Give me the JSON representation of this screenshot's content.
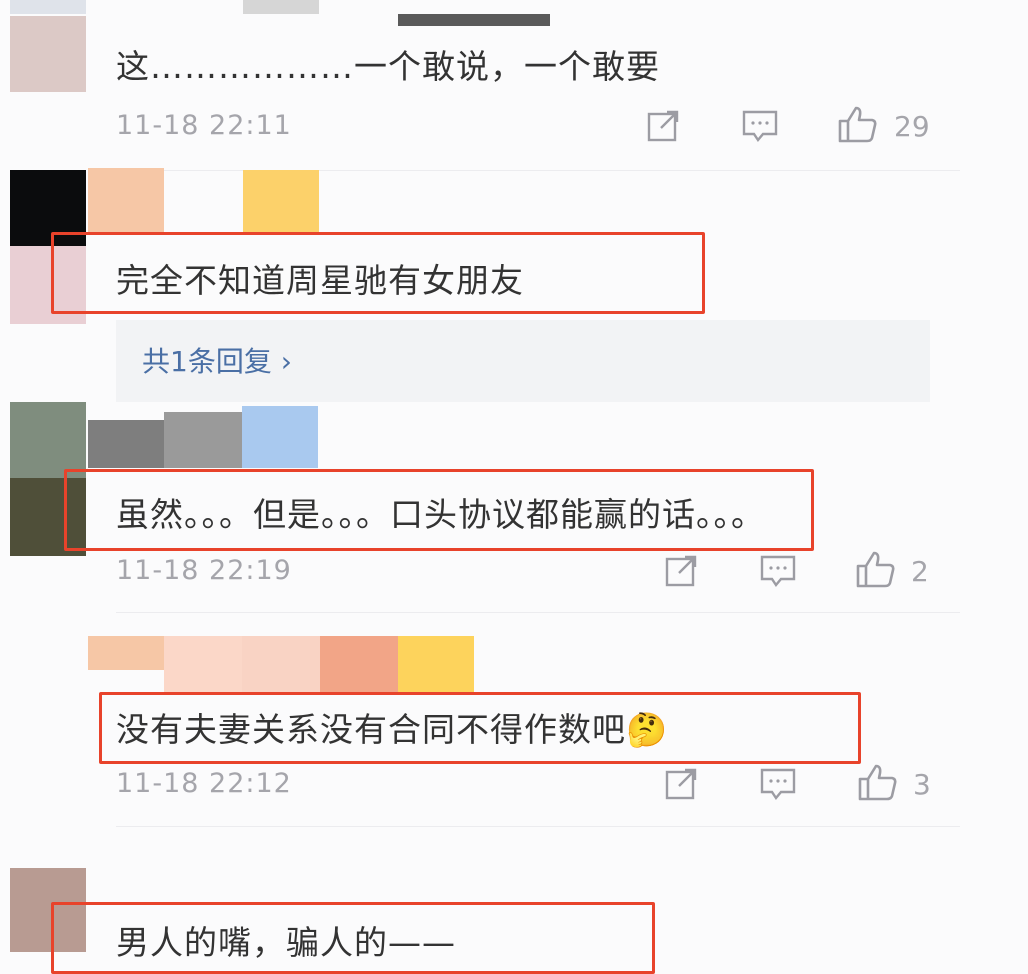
{
  "comments": [
    {
      "text": "这………………一个敢说，一个敢要",
      "time": "11-18 22:11",
      "likes": "29"
    },
    {
      "text": "完全不知道周星驰有女朋友",
      "reply_link": "共1条回复 ›"
    },
    {
      "text": "虽然。。。但是。。。口头协议都能赢的话。。。",
      "time": "11-18 22:19",
      "likes": "2"
    },
    {
      "text": "没有夫妻关系没有合同不得作数吧",
      "emoji": "🤔",
      "time": "11-18 22:12",
      "likes": "3"
    },
    {
      "text": "男人的嘴，骗人的——"
    }
  ],
  "colors": {
    "highlight_box": "#e8432b",
    "reply_link": "#4a6fa5",
    "meta_gray": "#a5a5ab"
  },
  "icons": [
    "share-icon",
    "comment-icon",
    "like-icon"
  ]
}
